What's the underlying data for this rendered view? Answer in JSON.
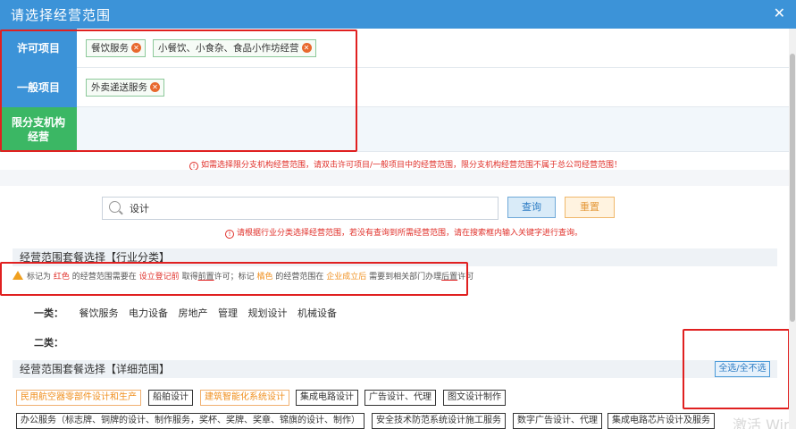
{
  "dialog": {
    "title": "请选择经营范围",
    "close": "✕"
  },
  "categories": {
    "licensed": {
      "label": "许可项目",
      "tags": [
        "餐饮服务",
        "小餐饮、小食杂、食品小作坊经营"
      ]
    },
    "general": {
      "label": "一般项目",
      "tags": [
        "外卖递送服务"
      ]
    },
    "branch": {
      "label_line1": "限分支机构",
      "label_line2": "经营",
      "tags": []
    }
  },
  "branch_hint": "如需选择限分支机构经营范围，请双击许可项目/一般项目中的经营范围，限分支机构经营范围不属于总公司经营范围！",
  "search": {
    "value": "设计",
    "query_label": "查询",
    "reset_label": "重置"
  },
  "search_hint": "请根据行业分类选择经营范围，若没有查询到所需经营范围，请在搜索框内输入关键字进行查询。",
  "industry_section": {
    "title": "经营范围套餐选择【行业分类】"
  },
  "warning": {
    "p1": "标记为",
    "red": "红色",
    "p2": "的经营范围需要在",
    "p3": "设立登记前",
    "p4": "取得",
    "p5": "前置",
    "p6": "许可；标记",
    "orange": "橘色",
    "p7": "的经营范围在",
    "p8": "企业成立后",
    "p9": "需要到相关部门办理",
    "p10": "后置",
    "p11": "许可"
  },
  "class1": {
    "label": "一类：",
    "items": [
      "餐饮服务",
      "电力设备",
      "房地产",
      "管理",
      "规划设计",
      "机械设备"
    ]
  },
  "class2": {
    "label": "二类："
  },
  "detail_section": {
    "title": "经营范围套餐选择【详细范围】",
    "select_all": "全选/全不选"
  },
  "detail_row1": [
    "民用航空器零部件设计和生产",
    "船舶设计",
    "建筑智能化系统设计",
    "集成电路设计",
    "广告设计、代理",
    "图文设计制作"
  ],
  "detail_row2": [
    "办公服务（标志牌、铜牌的设计、制作服务，奖杯、奖牌、奖章、锦旗的设计、制作）",
    "安全技术防范系统设计施工服务",
    "数字广告设计、代理",
    "集成电路芯片设计及服务"
  ],
  "watermark": "激活 Windows",
  "colors": {
    "title_bar": "#3c93d8",
    "licensed_label": "#3c93d8",
    "branch_label": "#3bb764",
    "tag_close": "#e8682d",
    "highlight_box": "#e02020",
    "orange_item": "#f09020"
  }
}
